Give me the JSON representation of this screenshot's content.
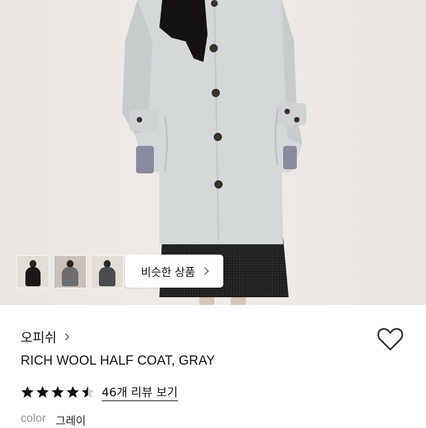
{
  "product": {
    "brand": "오피쉬",
    "title": "RICH WOOL HALF COAT, GRAY",
    "rating": 4.5,
    "review_link": "46개 리뷰 보기",
    "color_label": "color",
    "color_value": "그레이"
  },
  "gallery": {
    "similar_button": "비슷한 상품",
    "thumbnail_count": 3
  },
  "icons": [
    "heart-icon",
    "chevron-right-icon",
    "star-icon"
  ]
}
